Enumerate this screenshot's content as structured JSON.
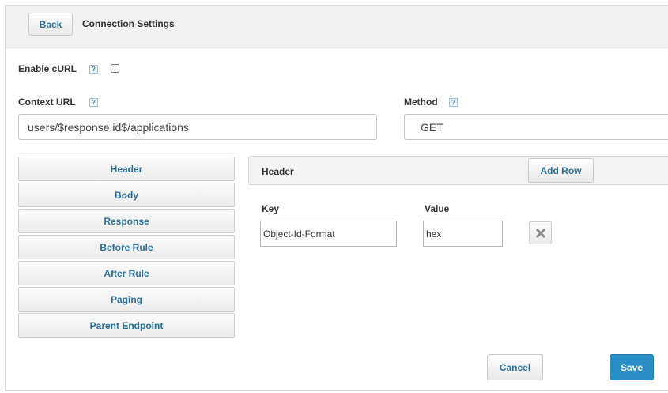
{
  "header": {
    "back_label": "Back",
    "title": "Connection Settings"
  },
  "help_glyph": "?",
  "enable_curl": {
    "label": "Enable cURL",
    "checked": false
  },
  "context_url": {
    "label": "Context URL",
    "value": "users/$response.id$/applications"
  },
  "method": {
    "label": "Method",
    "value": "GET"
  },
  "tabs": [
    {
      "label": "Header"
    },
    {
      "label": "Body"
    },
    {
      "label": "Response"
    },
    {
      "label": "Before Rule"
    },
    {
      "label": "After Rule"
    },
    {
      "label": "Paging"
    },
    {
      "label": "Parent Endpoint"
    }
  ],
  "panel": {
    "title": "Header",
    "add_row_label": "Add Row",
    "key_header": "Key",
    "value_header": "Value",
    "rows": [
      {
        "key": "Object-Id-Format",
        "value": "hex"
      }
    ]
  },
  "footer": {
    "cancel_label": "Cancel",
    "save_label": "Save"
  },
  "colors": {
    "accent": "#2a6f9a",
    "save_button": "#2a8ec6"
  },
  "icons": {
    "delete": "close-icon",
    "help": "help-icon"
  }
}
